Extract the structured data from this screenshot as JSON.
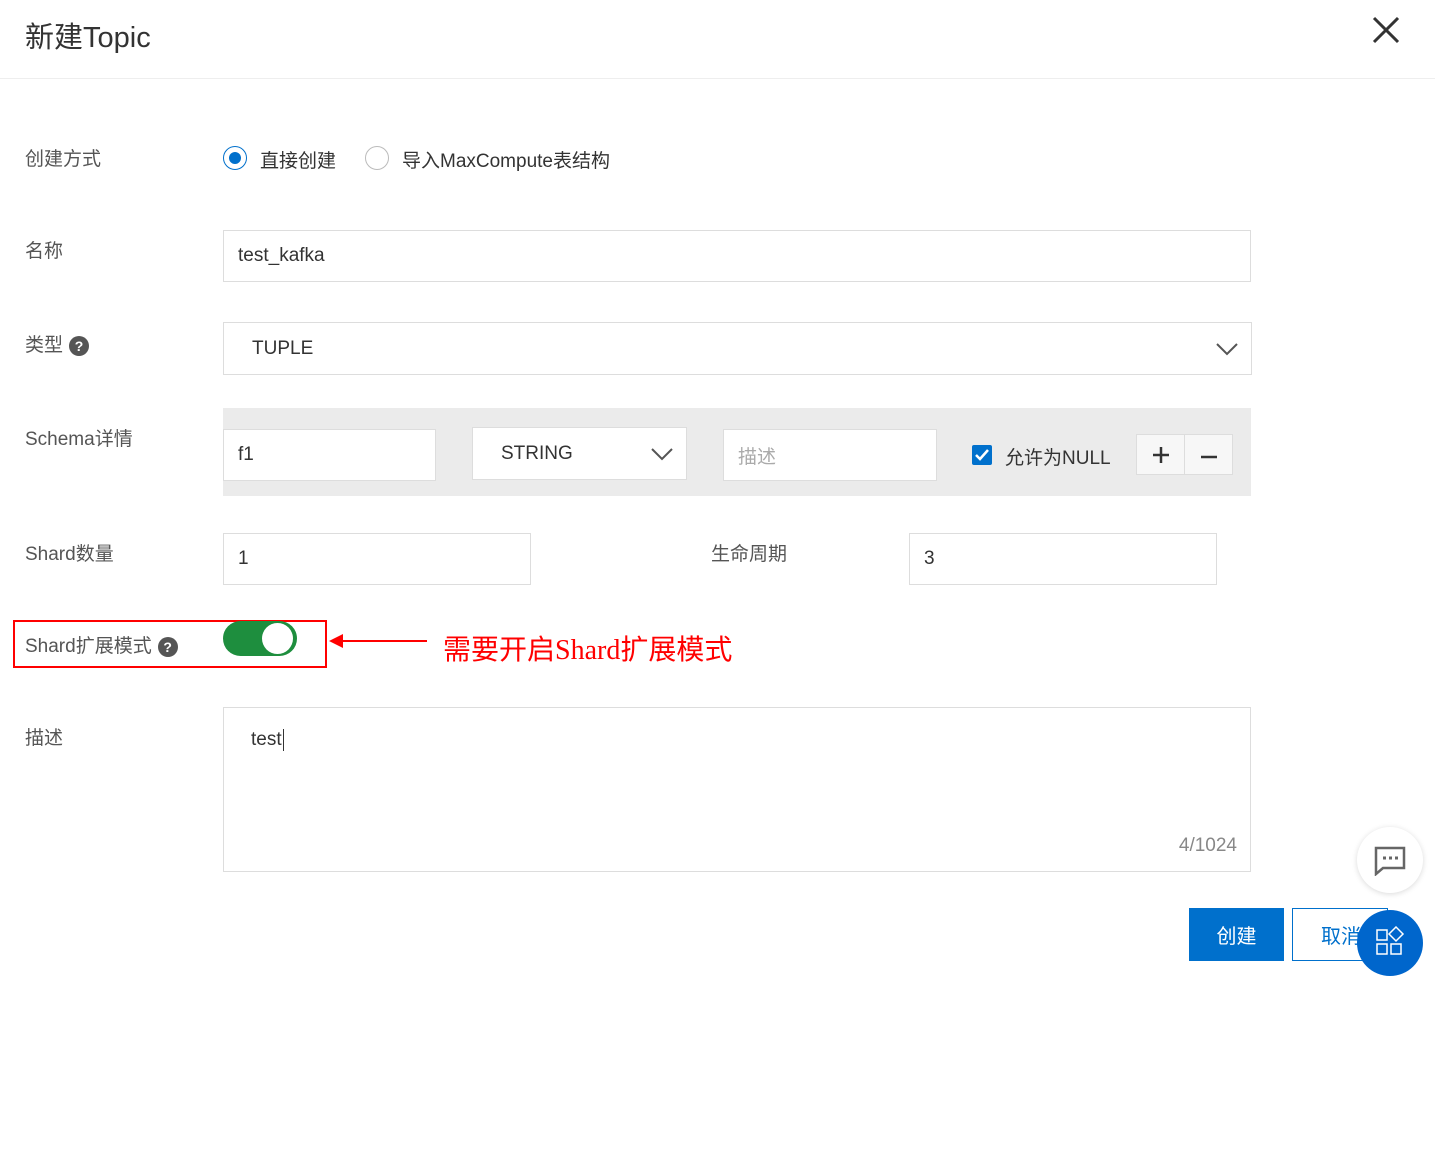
{
  "dialog": {
    "title": "新建Topic"
  },
  "form": {
    "create_method": {
      "label": "创建方式",
      "options": [
        "直接创建",
        "导入MaxCompute表结构"
      ],
      "selected": "直接创建"
    },
    "name": {
      "label": "名称",
      "value": "test_kafka"
    },
    "type": {
      "label": "类型",
      "value": "TUPLE"
    },
    "schema": {
      "label": "Schema详情",
      "field_name": "f1",
      "field_type": "STRING",
      "desc_placeholder": "描述",
      "allow_null_label": "允许为NULL",
      "allow_null": true
    },
    "shard_count": {
      "label": "Shard数量",
      "value": "1"
    },
    "lifecycle": {
      "label": "生命周期",
      "value": "3"
    },
    "shard_extend": {
      "label": "Shard扩展模式",
      "enabled": true
    },
    "description": {
      "label": "描述",
      "value": "test",
      "counter": "4/1024"
    }
  },
  "annotation": {
    "text": "需要开启Shard扩展模式",
    "color": "#ff0000"
  },
  "actions": {
    "create": "创建",
    "cancel": "取消"
  },
  "colors": {
    "primary": "#0070cc",
    "toggle_on": "#1e8e3e"
  }
}
